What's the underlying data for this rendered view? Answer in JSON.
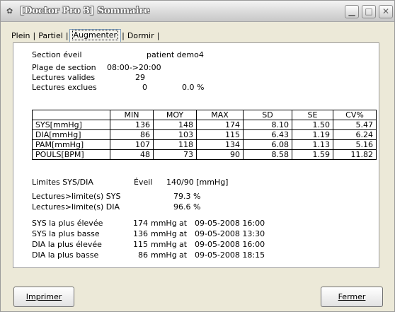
{
  "window": {
    "title": "[Doctor Pro 3] Sommaire",
    "minimize": "▁",
    "maximize": "□",
    "close": "✕"
  },
  "tabs": [
    "Plein",
    "Partiel",
    "Augmenter",
    "Dormir"
  ],
  "active_tab": "Augmenter",
  "summary": {
    "section_label": "Section éveil",
    "patient": "patient demo4",
    "range_label": "Plage de section",
    "range_value": "08:00->20:00",
    "valid_label": "Lectures valides",
    "valid_value": "29",
    "excluded_label": "Lectures exclues",
    "excluded_value": "0",
    "excluded_pct": "0.0 %"
  },
  "table": {
    "columns": [
      "",
      "MIN",
      "MOY",
      "MAX",
      "SD",
      "SE",
      "CV%"
    ],
    "rows": [
      {
        "label": "SYS[mmHg]",
        "min": "136",
        "moy": "148",
        "max": "174",
        "sd": "8.10",
        "se": "1.50",
        "cv": "5.47"
      },
      {
        "label": "DIA[mmHg]",
        "min": "86",
        "moy": "103",
        "max": "115",
        "sd": "6.43",
        "se": "1.19",
        "cv": "6.24"
      },
      {
        "label": "PAM[mmHg]",
        "min": "107",
        "moy": "118",
        "max": "134",
        "sd": "6.08",
        "se": "1.13",
        "cv": "5.16"
      },
      {
        "label": "POULS[BPM]",
        "min": "48",
        "moy": "73",
        "max": "90",
        "sd": "8.58",
        "se": "1.59",
        "cv": "11.82"
      }
    ]
  },
  "limits": {
    "label": "Limites SYS/DIA",
    "mode": "Éveil",
    "value": "140/90 [mmHg]",
    "sys_label": "Lectures>limite(s) SYS",
    "sys_pct": "79.3 %",
    "dia_label": "Lectures>limite(s) DIA",
    "dia_pct": "96.6 %"
  },
  "extremes": [
    {
      "label": "SYS la plus élevée",
      "value": "174",
      "unit": "mmHg",
      "at": "at",
      "datetime": "09-05-2008 16:00"
    },
    {
      "label": "SYS la plus basse",
      "value": "136",
      "unit": "mmHg",
      "at": "at",
      "datetime": "09-05-2008 13:30"
    },
    {
      "label": "DIA la plus élevée",
      "value": "115",
      "unit": "mmHg",
      "at": "at",
      "datetime": "09-05-2008 16:00"
    },
    {
      "label": "DIA la plus basse",
      "value": "86",
      "unit": "mmHg",
      "at": "at",
      "datetime": "09-05-2008 18:15"
    }
  ],
  "buttons": {
    "print": "Imprimer",
    "close": "Fermer"
  }
}
